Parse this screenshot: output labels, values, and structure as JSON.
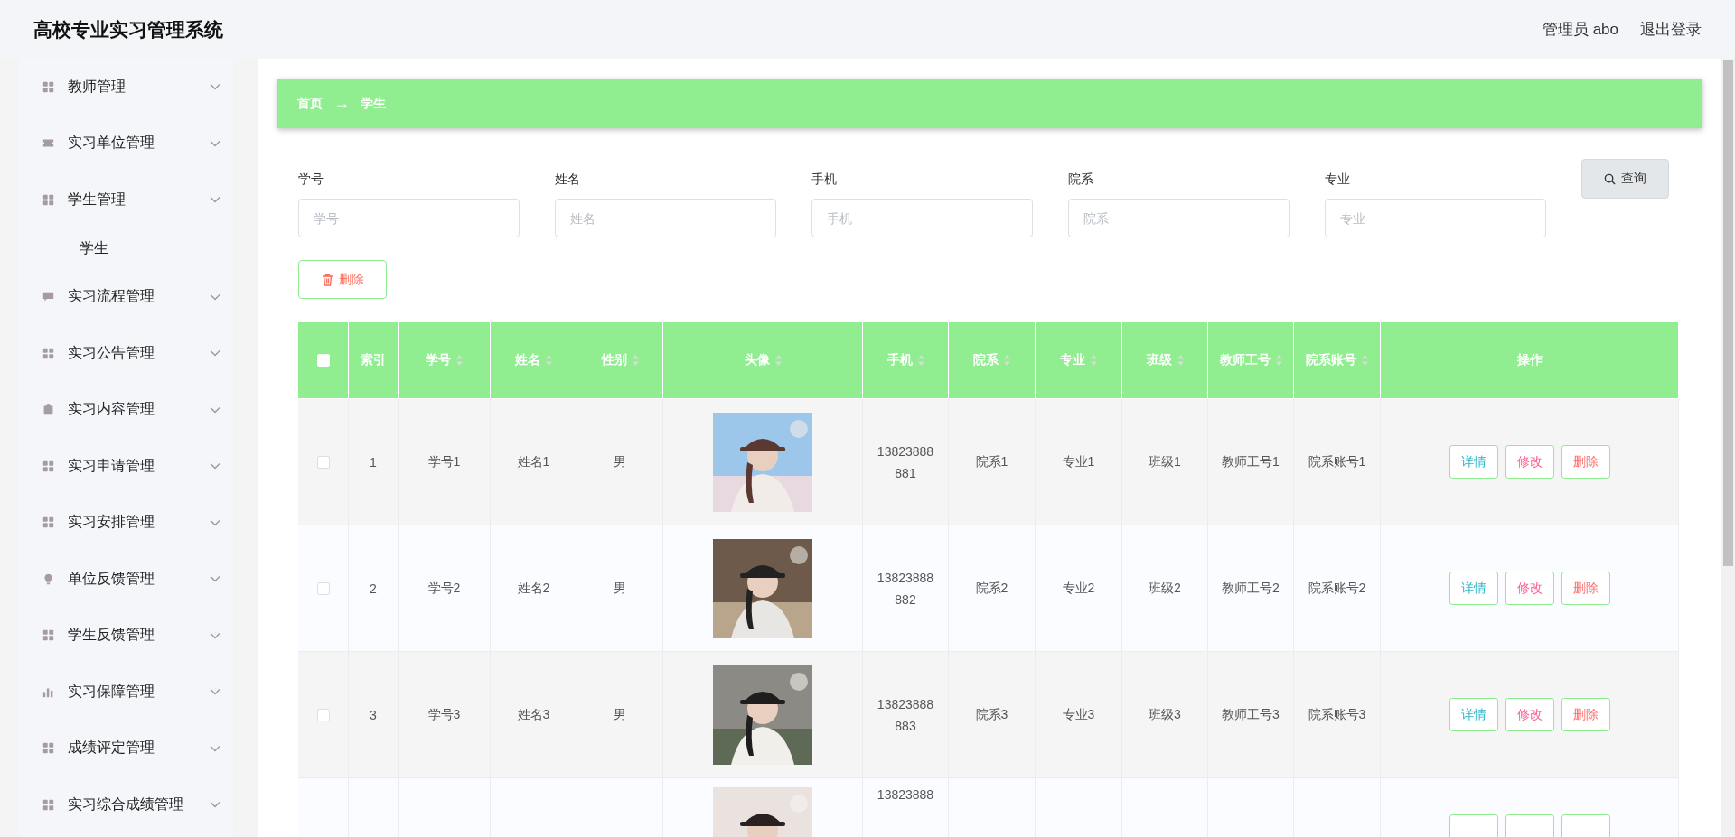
{
  "header": {
    "title": "高校专业实习管理系统",
    "user": "管理员 abo",
    "logout": "退出登录"
  },
  "sidebar": {
    "items": [
      {
        "label": "教师管理",
        "kind": "grid"
      },
      {
        "label": "实习单位管理",
        "kind": "ticket"
      },
      {
        "label": "学生管理",
        "kind": "grid",
        "children": [
          {
            "label": "学生"
          }
        ]
      },
      {
        "label": "实习流程管理",
        "kind": "chat"
      },
      {
        "label": "实习公告管理",
        "kind": "grid"
      },
      {
        "label": "实习内容管理",
        "kind": "clipboard"
      },
      {
        "label": "实习申请管理",
        "kind": "grid"
      },
      {
        "label": "实习安排管理",
        "kind": "grid"
      },
      {
        "label": "单位反馈管理",
        "kind": "bulb"
      },
      {
        "label": "学生反馈管理",
        "kind": "grid"
      },
      {
        "label": "实习保障管理",
        "kind": "chart"
      },
      {
        "label": "成绩评定管理",
        "kind": "grid"
      },
      {
        "label": "实习综合成绩管理",
        "kind": "grid"
      }
    ]
  },
  "breadcrumb": {
    "items": [
      "首页",
      "学生"
    ],
    "separator": "→"
  },
  "search": {
    "fields": [
      {
        "label": "学号",
        "placeholder": "学号"
      },
      {
        "label": "姓名",
        "placeholder": "姓名"
      },
      {
        "label": "手机",
        "placeholder": "手机"
      },
      {
        "label": "院系",
        "placeholder": "院系"
      },
      {
        "label": "专业",
        "placeholder": "专业"
      }
    ],
    "query_button": "查询"
  },
  "delete_button": "删除",
  "table": {
    "header_checked": false,
    "columns": [
      {
        "label": "索引",
        "sortable": false
      },
      {
        "label": "学号",
        "sortable": true
      },
      {
        "label": "姓名",
        "sortable": true
      },
      {
        "label": "性别",
        "sortable": true
      },
      {
        "label": "头像",
        "sortable": true
      },
      {
        "label": "手机",
        "sortable": true
      },
      {
        "label": "院系",
        "sortable": true
      },
      {
        "label": "专业",
        "sortable": true
      },
      {
        "label": "班级",
        "sortable": true
      },
      {
        "label": "教师工号",
        "sortable": true
      },
      {
        "label": "院系账号",
        "sortable": true
      },
      {
        "label": "操作",
        "sortable": false
      }
    ],
    "rows": [
      {
        "kind": "full",
        "checked": false,
        "index": "1",
        "student_no": "学号1",
        "name": "姓名1",
        "gender": "男",
        "photo": {
          "kind": "picture"
        },
        "phone": "13823888881",
        "department": "院系1",
        "major": "专业1",
        "class": "班级1",
        "teacher_no": "教师工号1",
        "department_account": "院系账号1",
        "actions": [
          {
            "kind": "detail",
            "label": "详情"
          },
          {
            "kind": "edit",
            "label": "修改"
          },
          {
            "kind": "delete",
            "label": "删除"
          }
        ]
      },
      {
        "kind": "full",
        "checked": false,
        "index": "2",
        "student_no": "学号2",
        "name": "姓名2",
        "gender": "男",
        "photo": {
          "kind": "picture"
        },
        "phone": "13823888882",
        "department": "院系2",
        "major": "专业2",
        "class": "班级2",
        "teacher_no": "教师工号2",
        "department_account": "院系账号2",
        "actions": [
          {
            "kind": "detail",
            "label": "详情"
          },
          {
            "kind": "edit",
            "label": "修改"
          },
          {
            "kind": "delete",
            "label": "删除"
          }
        ]
      },
      {
        "kind": "full",
        "checked": false,
        "index": "3",
        "student_no": "学号3",
        "name": "姓名3",
        "gender": "男",
        "photo": {
          "kind": "picture"
        },
        "phone": "13823888883",
        "department": "院系3",
        "major": "专业3",
        "class": "班级3",
        "teacher_no": "教师工号3",
        "department_account": "院系账号3",
        "actions": [
          {
            "kind": "detail",
            "label": "详情"
          },
          {
            "kind": "edit",
            "label": "修改"
          },
          {
            "kind": "delete",
            "label": "删除"
          }
        ]
      },
      {
        "kind": "cut",
        "photo": {
          "kind": "picture"
        },
        "phone": "13823888",
        "actions": [
          {
            "kind": "detail"
          },
          {
            "kind": "edit"
          },
          {
            "kind": "delete"
          }
        ]
      }
    ]
  }
}
